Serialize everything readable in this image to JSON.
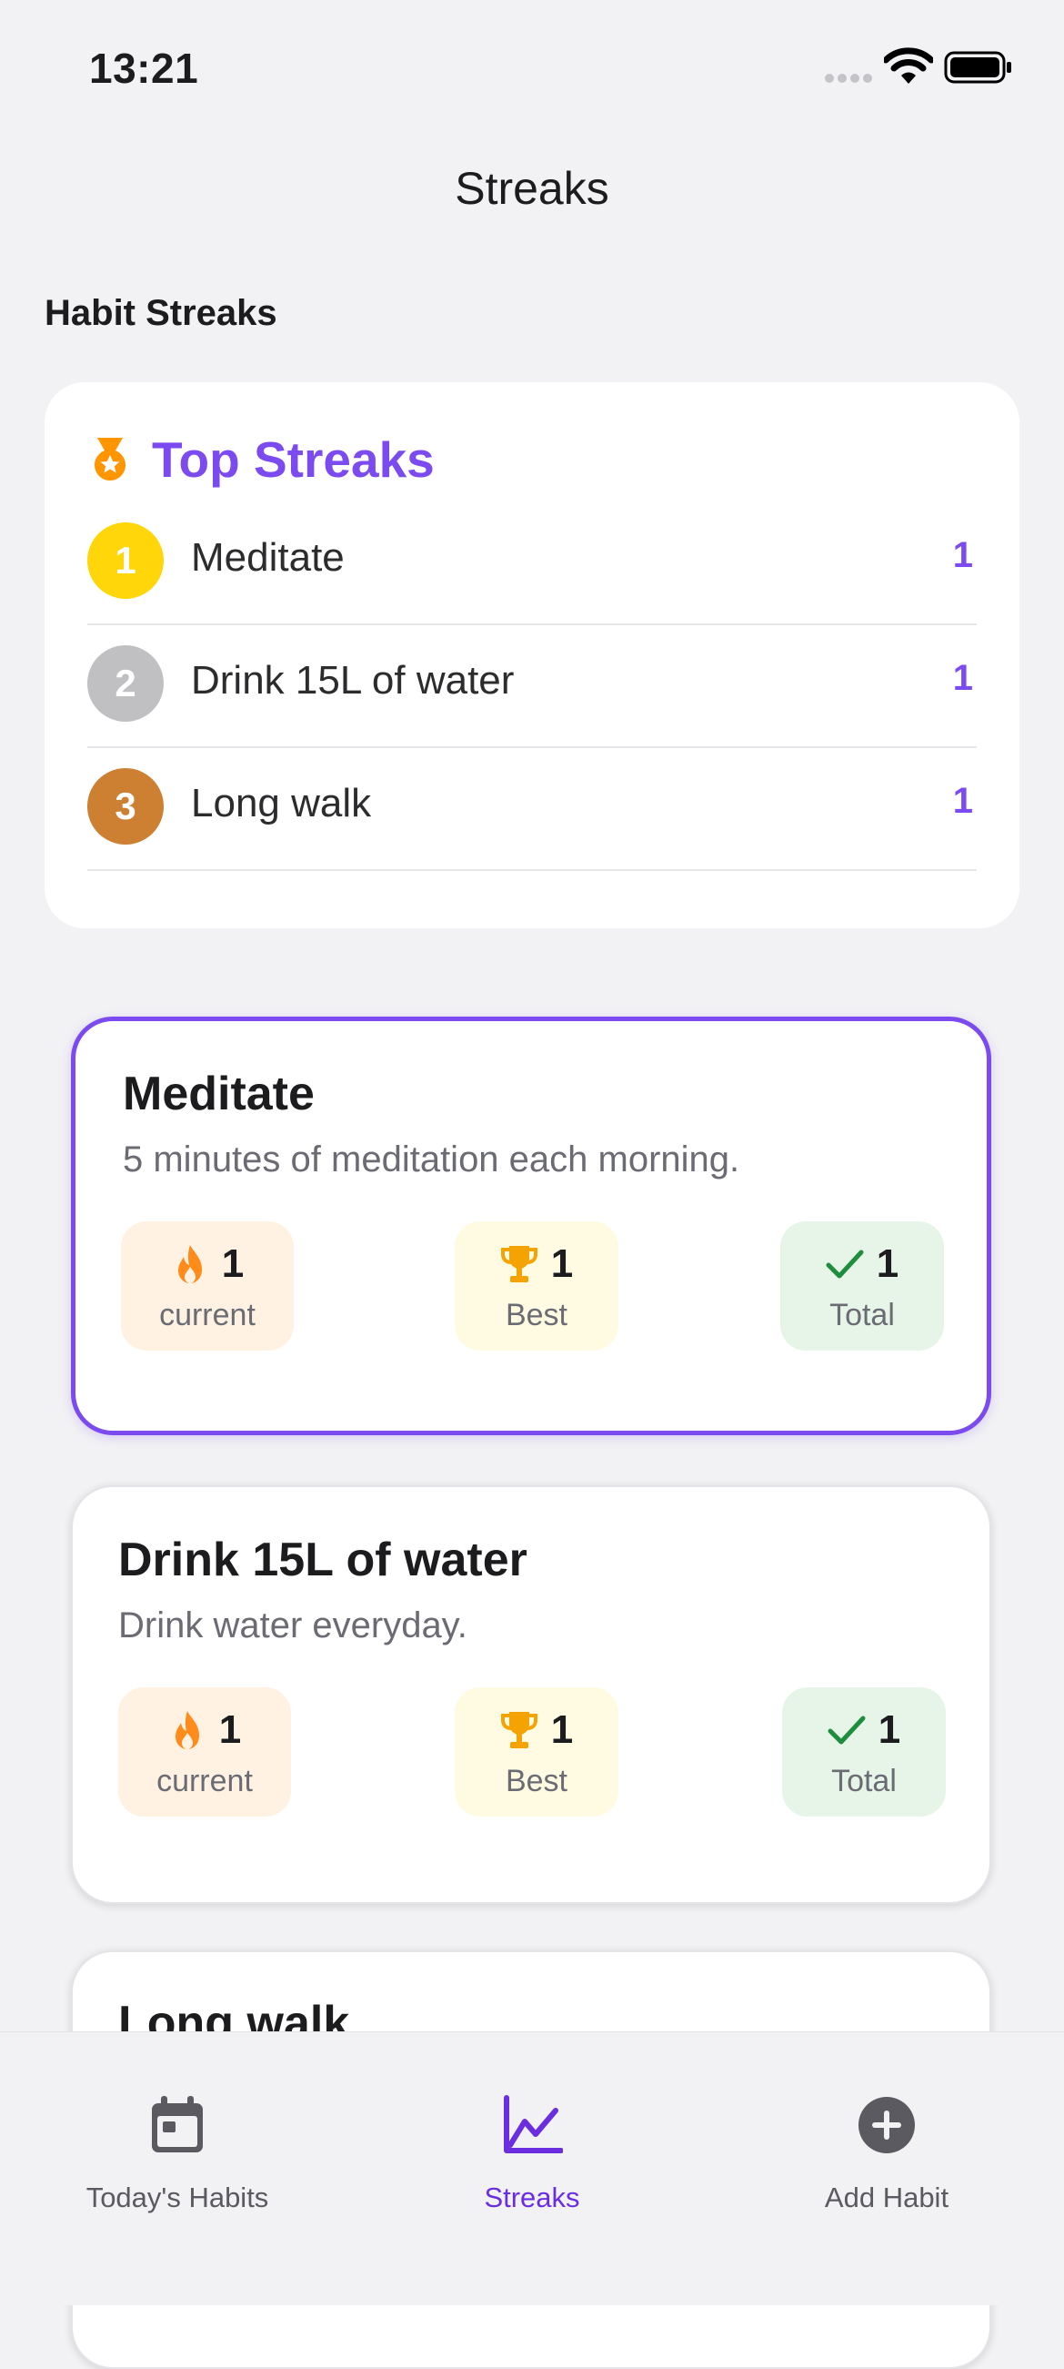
{
  "status_bar": {
    "time": "13:21"
  },
  "nav": {
    "title": "Streaks"
  },
  "section": {
    "title": "Habit Streaks"
  },
  "top_streaks": {
    "title": "Top Streaks",
    "icon": "medal-icon",
    "items": [
      {
        "rank": "1",
        "name": "Meditate",
        "value": "1",
        "color": "#ffd60a"
      },
      {
        "rank": "2",
        "name": "Drink 15L of water",
        "value": "1",
        "color": "#c0c0c2"
      },
      {
        "rank": "3",
        "name": "Long walk",
        "value": "1",
        "color": "#cd7f32"
      }
    ]
  },
  "habits": [
    {
      "name": "Meditate",
      "description": "5 minutes of meditation each morning.",
      "current": "1",
      "current_label": "current",
      "best": "1",
      "best_label": "Best",
      "total": "1",
      "total_label": "Total",
      "selected": true
    },
    {
      "name": "Drink 15L of water",
      "description": "Drink water everyday.",
      "current": "1",
      "current_label": "current",
      "best": "1",
      "best_label": "Best",
      "total": "1",
      "total_label": "Total",
      "selected": false
    },
    {
      "name": "Long walk"
    }
  ],
  "tab_bar": {
    "tabs": [
      {
        "label": "Today's Habits",
        "icon": "calendar-icon",
        "active": false
      },
      {
        "label": "Streaks",
        "icon": "chart-icon",
        "active": true
      },
      {
        "label": "Add Habit",
        "icon": "plus-circle-icon",
        "active": false
      }
    ]
  },
  "colors": {
    "accent": "#7b4bf0",
    "flame": "#ff8c1a",
    "trophy": "#f5a300",
    "check": "#1e8e3e"
  }
}
